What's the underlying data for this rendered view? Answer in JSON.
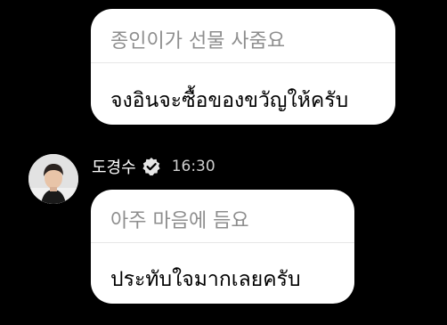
{
  "messages": [
    {
      "original": "종인이가 선물 사줌요",
      "translated": "จงอินจะซื้อของขวัญให้ครับ"
    },
    {
      "original": "아주 마음에 듬요",
      "translated": "ประทับใจมากเลยครับ"
    }
  ],
  "sender": {
    "name": "도경수",
    "time": "16:30",
    "verified_icon": "verified-badge-icon",
    "avatar": "profile-avatar"
  },
  "colors": {
    "background": "#000000",
    "bubble": "#ffffff",
    "original_text": "#8e8e8e",
    "translated_text": "#000000",
    "time_text": "#cfcfcf"
  }
}
